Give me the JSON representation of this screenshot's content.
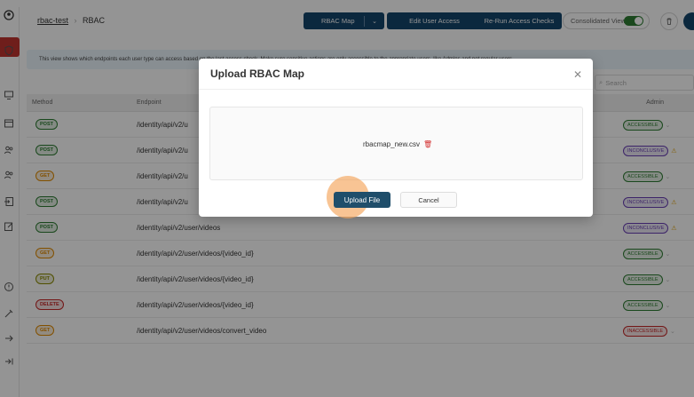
{
  "app": {
    "breadcrumb_link": "rbac-test",
    "breadcrumb_current": "RBAC"
  },
  "toolbar": {
    "rbac_map_label": "RBAC Map",
    "edit_access_label": "Edit User Access",
    "rerun_label": "Re-Run Access Checks",
    "consolidated_label": "Consolidated View",
    "consolidated_on": true
  },
  "info": {
    "banner": "This view shows which endpoints each user type can access based on the last access check. Make sure sensitive actions are only accessible to the appropriate users, like Admins and not regular users."
  },
  "search": {
    "placeholder": "Search"
  },
  "table": {
    "headers": {
      "method": "Method",
      "endpoint": "Endpoint",
      "admin": "Admin"
    },
    "rows": [
      {
        "method": "POST",
        "endpoint": "/identity/api/v2/u",
        "status": "ACCESSIBLE"
      },
      {
        "method": "POST",
        "endpoint": "/identity/api/v2/u",
        "status": "INCONCLUSIVE"
      },
      {
        "method": "GET",
        "endpoint": "/identity/api/v2/u",
        "status": "ACCESSIBLE"
      },
      {
        "method": "POST",
        "endpoint": "/identity/api/v2/u",
        "status": "INCONCLUSIVE"
      },
      {
        "method": "POST",
        "endpoint": "/identity/api/v2/user/videos",
        "status": "INCONCLUSIVE"
      },
      {
        "method": "GET",
        "endpoint": "/identity/api/v2/user/videos/{video_id}",
        "status": "ACCESSIBLE"
      },
      {
        "method": "PUT",
        "endpoint": "/identity/api/v2/user/videos/{video_id}",
        "status": "ACCESSIBLE"
      },
      {
        "method": "DELETE",
        "endpoint": "/identity/api/v2/user/videos/{video_id}",
        "status": "ACCESSIBLE"
      },
      {
        "method": "GET",
        "endpoint": "/identity/api/v2/user/videos/convert_video",
        "status": "INACCESSIBLE"
      }
    ]
  },
  "modal": {
    "title": "Upload RBAC Map",
    "file_name": "rbacmap_new.csv",
    "upload_label": "Upload File",
    "cancel_label": "Cancel"
  },
  "colors": {
    "brand": "#14456b",
    "POST": "#2e7d32",
    "GET": "#e08a00",
    "PUT": "#8a8a00",
    "DELETE": "#c62828",
    "ACCESSIBLE": "#2e7d32",
    "INCONCLUSIVE": "#6a3fb5",
    "INACCESSIBLE": "#c62828"
  }
}
